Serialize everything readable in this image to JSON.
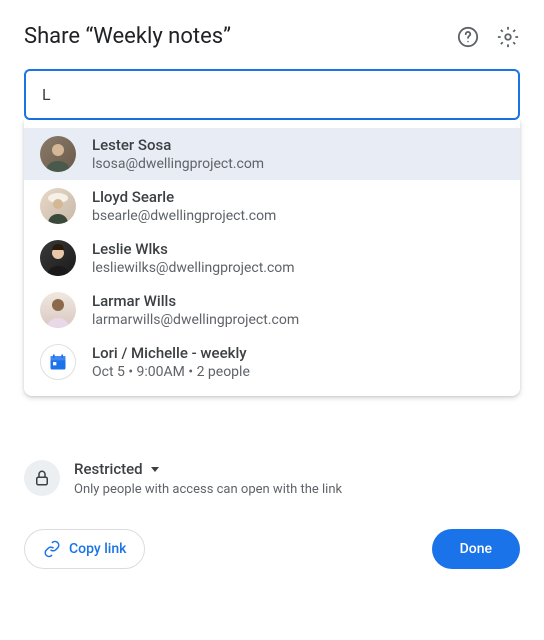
{
  "dialog": {
    "title": "Share “Weekly notes”"
  },
  "search": {
    "value": "L"
  },
  "suggestions": [
    {
      "name": "Lester Sosa",
      "sub": "lsosa@dwellingproject.com",
      "type": "person"
    },
    {
      "name": "Lloyd Searle",
      "sub": "bsearle@dwellingproject.com",
      "type": "person"
    },
    {
      "name": "Leslie Wlks",
      "sub": "lesliewilks@dwellingproject.com",
      "type": "person"
    },
    {
      "name": "Larmar Wills",
      "sub": "larmarwills@dwellingproject.com",
      "type": "person"
    },
    {
      "name": "Lori / Michelle - weekly",
      "sub": "Oct 5 • 9:00AM • 2 people",
      "type": "event"
    }
  ],
  "access": {
    "level": "Restricted",
    "description": "Only people with access can open with the link"
  },
  "footer": {
    "copy_link_label": "Copy link",
    "done_label": "Done"
  }
}
